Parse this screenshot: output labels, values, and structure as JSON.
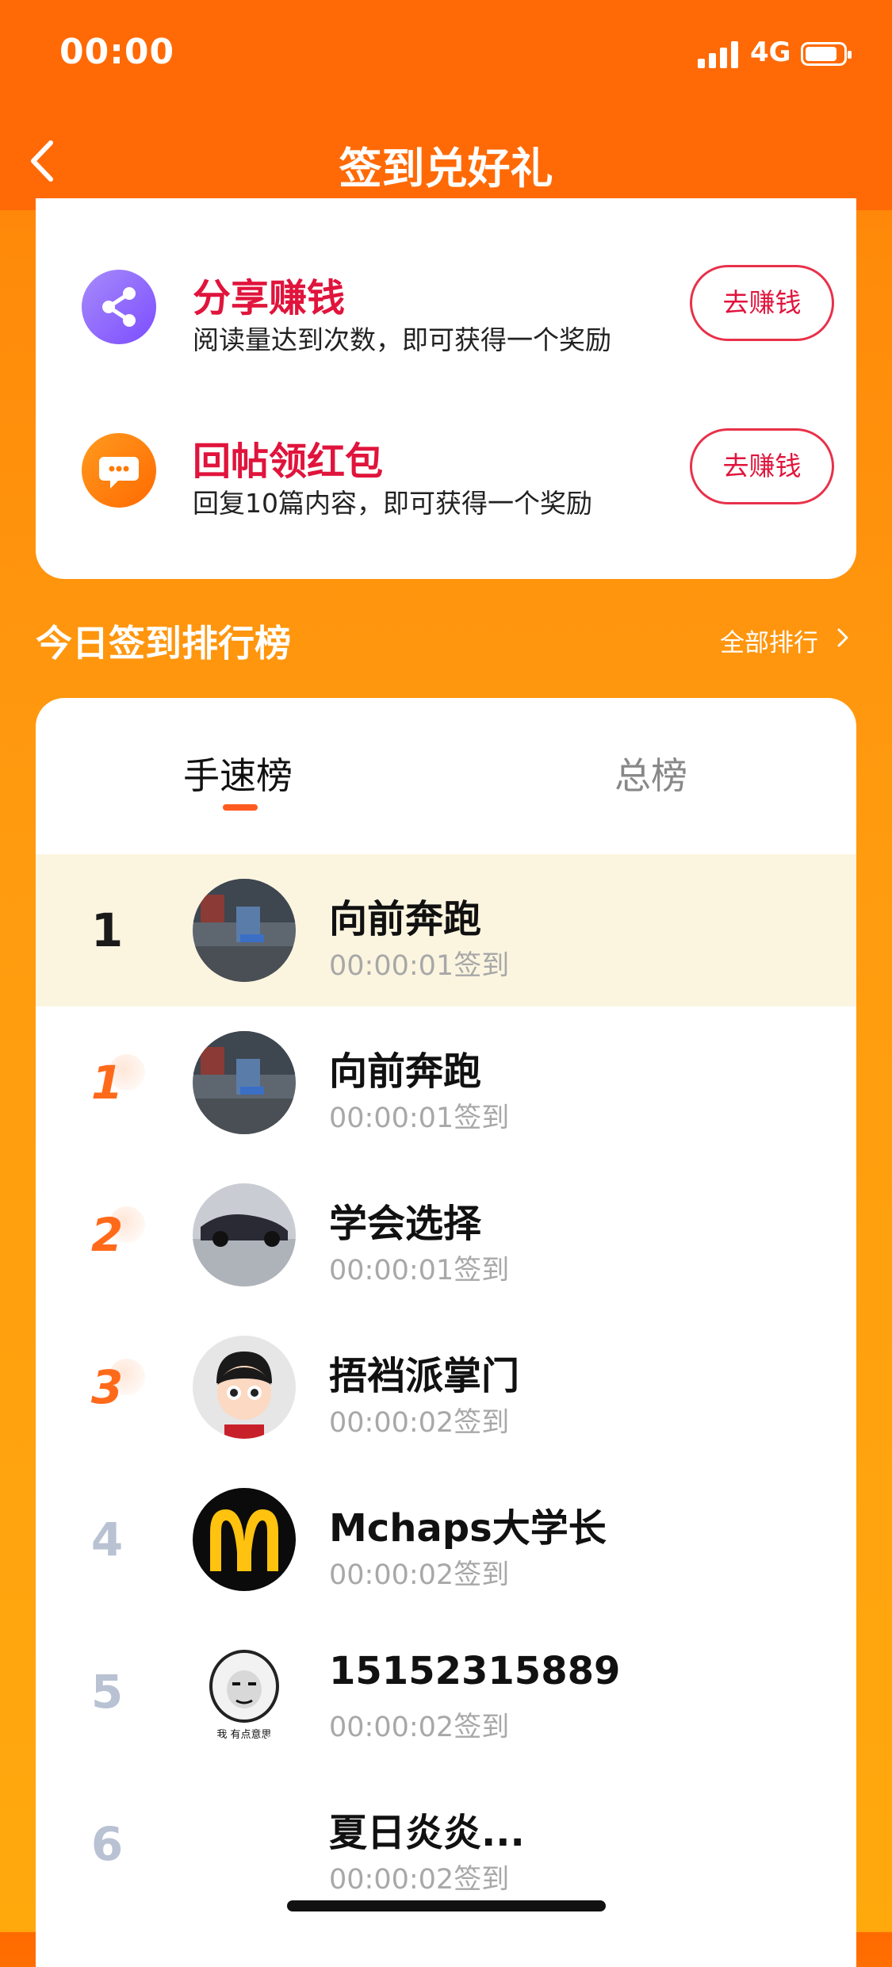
{
  "status_bar": {
    "time": "00:00",
    "network": "4G"
  },
  "navbar": {
    "title": "签到兑好礼"
  },
  "tasks": [
    {
      "title": "分享赚钱",
      "desc": "阅读量达到次数，即可获得一个奖励",
      "button": "去赚钱",
      "icon": "share-icon",
      "icon_color": "#8B5CF6"
    },
    {
      "title": "回帖领红包",
      "desc": "回复10篇内容，即可获得一个奖励",
      "button": "去赚钱",
      "icon": "chat-bubble-icon",
      "icon_color": "#FF7A00"
    }
  ],
  "ranking": {
    "heading": "今日签到排行榜",
    "all_link": "全部排行",
    "tabs": [
      "手速榜",
      "总榜"
    ],
    "active_tab": "手速榜",
    "rows": [
      {
        "rank": "1",
        "name": "向前奔跑",
        "time": "00:00:01签到",
        "avatar": "street-photo"
      },
      {
        "rank": "1",
        "name": "向前奔跑",
        "time": "00:00:01签到",
        "avatar": "street-photo"
      },
      {
        "rank": "2",
        "name": "学会选择",
        "time": "00:00:01签到",
        "avatar": "sports-car-photo"
      },
      {
        "rank": "3",
        "name": "捂裆派掌门",
        "time": "00:00:02签到",
        "avatar": "cartoon-boy"
      },
      {
        "rank": "4",
        "name": "Mchaps大学长",
        "time": "00:00:02签到",
        "avatar": "golden-arches-logo"
      },
      {
        "rank": "5",
        "name": "15152315889",
        "time": "00:00:02签到",
        "avatar": "meme-face",
        "avatar_caption": "我 有点意思"
      },
      {
        "rank": "6",
        "name": "夏日炎炎...",
        "time": "00:00:02签到",
        "avatar": "blank"
      }
    ]
  },
  "colors": {
    "brand_orange": "#FF6A06",
    "task_red": "#E0143C",
    "highlight_row": "#FBF5E0"
  }
}
